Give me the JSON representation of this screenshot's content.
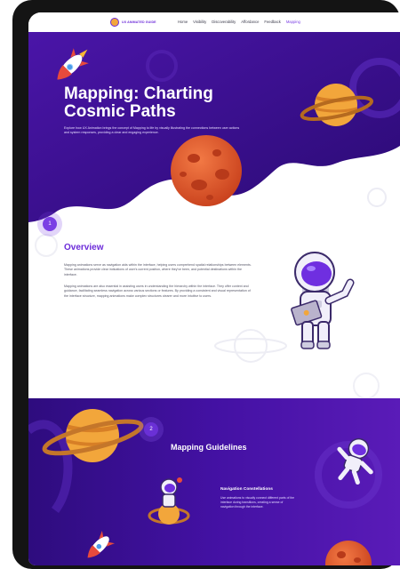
{
  "site": {
    "logo_text": "UX ANIMATED GUIDE"
  },
  "nav": {
    "items": [
      {
        "label": "Home",
        "active": false
      },
      {
        "label": "Visibility",
        "active": false
      },
      {
        "label": "Discoverability",
        "active": false
      },
      {
        "label": "Affordance",
        "active": false
      },
      {
        "label": "Feedback",
        "active": false
      },
      {
        "label": "Mapping",
        "active": true
      }
    ]
  },
  "hero": {
    "title": "Mapping: Charting Cosmic Paths",
    "description": "Explore how UX Animation brings the concept of Mapping to life by visually illustrating the connections between user actions and system responses, providing a clear and engaging experience."
  },
  "overview": {
    "step": "1",
    "title": "Overview",
    "paragraph1": "Mapping animations serve as navigation aids within the interface, helping users comprehend spatial relationships between elements. These animations provide clear indications of user's current position, where they've been, and potential destinations within the interface.",
    "paragraph2": "Mapping animations are also essential in assisting users in understanding the hierarchy within the interface. They offer context and guidance, facilitating seamless navigation across various sections or features. By providing a consistent and visual representation of the interface structure, mapping animations make complex structures clearer and more intuitive to users."
  },
  "guidelines": {
    "step": "2",
    "title": "Mapping Guidelines",
    "items": [
      {
        "title": "Navigation Constellations",
        "text": "Use animations to visually connect different parts of the interface during transitions, creating a sense of navigation through the interface."
      }
    ]
  },
  "colors": {
    "accent": "#7b3fe4",
    "hero_purple": "#3d0f94",
    "deep_purple": "#2a0a73",
    "planet_orange": "#e85b2e",
    "saturn_gold": "#f2a63b"
  },
  "icons": [
    "rocket-icon",
    "saturn-planet-icon",
    "mars-planet-icon",
    "astronaut-laptop-icon",
    "astronaut-floating-icon",
    "astronaut-on-planet-icon"
  ]
}
